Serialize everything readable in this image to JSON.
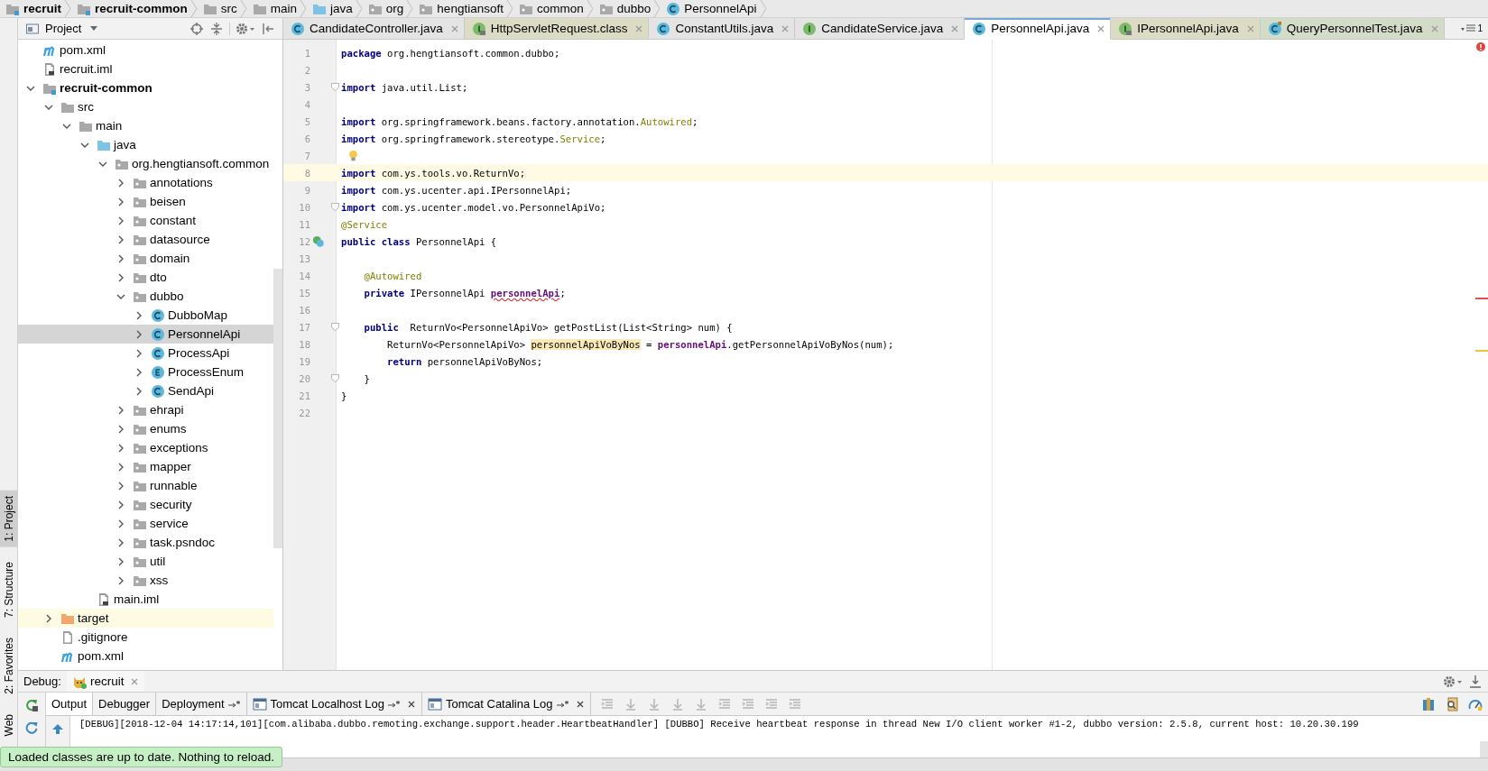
{
  "breadcrumbs": [
    {
      "label": "recruit",
      "kind": "module"
    },
    {
      "label": "recruit-common",
      "kind": "module"
    },
    {
      "label": "src",
      "kind": "folder"
    },
    {
      "label": "main",
      "kind": "folder"
    },
    {
      "label": "java",
      "kind": "source"
    },
    {
      "label": "org",
      "kind": "package"
    },
    {
      "label": "hengtiansoft",
      "kind": "package"
    },
    {
      "label": "common",
      "kind": "package"
    },
    {
      "label": "dubbo",
      "kind": "package"
    },
    {
      "label": "PersonnelApi",
      "kind": "class"
    }
  ],
  "project_panel": {
    "title": "Project",
    "tree": [
      {
        "label": "pom.xml",
        "kind": "maven",
        "selected": false
      },
      {
        "label": "recruit.iml",
        "kind": "iml",
        "selected": false
      },
      {
        "label": "recruit-common",
        "kind": "module",
        "selected": false,
        "expanded": true,
        "children": [
          {
            "label": "src",
            "kind": "folder",
            "selected": false,
            "expanded": true,
            "children": [
              {
                "label": "main",
                "kind": "folder",
                "selected": false,
                "expanded": true,
                "children": [
                  {
                    "label": "java",
                    "kind": "source",
                    "selected": false,
                    "expanded": true,
                    "children": [
                      {
                        "label": "org.hengtiansoft.common",
                        "kind": "package",
                        "selected": false,
                        "expanded": true,
                        "children": [
                          {
                            "label": "annotations",
                            "kind": "package",
                            "selected": false,
                            "expanded": false
                          },
                          {
                            "label": "beisen",
                            "kind": "package",
                            "selected": false,
                            "expanded": false
                          },
                          {
                            "label": "constant",
                            "kind": "package",
                            "selected": false,
                            "expanded": false
                          },
                          {
                            "label": "datasource",
                            "kind": "package",
                            "selected": false,
                            "expanded": false
                          },
                          {
                            "label": "domain",
                            "kind": "package",
                            "selected": false,
                            "expanded": false
                          },
                          {
                            "label": "dto",
                            "kind": "package",
                            "selected": false,
                            "expanded": false
                          },
                          {
                            "label": "dubbo",
                            "kind": "package",
                            "selected": false,
                            "expanded": true,
                            "children": [
                              {
                                "label": "DubboMap",
                                "kind": "class",
                                "selected": false,
                                "expanded": false
                              },
                              {
                                "label": "PersonnelApi",
                                "kind": "class",
                                "selected": true,
                                "expanded": false
                              },
                              {
                                "label": "ProcessApi",
                                "kind": "class",
                                "selected": false,
                                "expanded": false
                              },
                              {
                                "label": "ProcessEnum",
                                "kind": "enum",
                                "selected": false,
                                "expanded": false
                              },
                              {
                                "label": "SendApi",
                                "kind": "class",
                                "selected": false,
                                "expanded": false
                              }
                            ]
                          },
                          {
                            "label": "ehrapi",
                            "kind": "package",
                            "selected": false,
                            "expanded": false
                          },
                          {
                            "label": "enums",
                            "kind": "package",
                            "selected": false,
                            "expanded": false
                          },
                          {
                            "label": "exceptions",
                            "kind": "package",
                            "selected": false,
                            "expanded": false
                          },
                          {
                            "label": "mapper",
                            "kind": "package",
                            "selected": false,
                            "expanded": false
                          },
                          {
                            "label": "runnable",
                            "kind": "package",
                            "selected": false,
                            "expanded": false
                          },
                          {
                            "label": "security",
                            "kind": "package",
                            "selected": false,
                            "expanded": false
                          },
                          {
                            "label": "service",
                            "kind": "package",
                            "selected": false,
                            "expanded": false
                          },
                          {
                            "label": "task.psndoc",
                            "kind": "package",
                            "selected": false,
                            "expanded": false
                          },
                          {
                            "label": "util",
                            "kind": "package",
                            "selected": false,
                            "expanded": false
                          },
                          {
                            "label": "xss",
                            "kind": "package",
                            "selected": false,
                            "expanded": false
                          }
                        ]
                      }
                    ]
                  },
                  {
                    "label": "main.iml",
                    "kind": "iml",
                    "selected": false
                  }
                ]
              }
            ]
          },
          {
            "label": "target",
            "kind": "excluded",
            "selected": false,
            "expanded": false
          },
          {
            "label": ".gitignore",
            "kind": "file",
            "selected": false
          },
          {
            "label": "pom.xml",
            "kind": "maven",
            "selected": false
          }
        ]
      }
    ]
  },
  "side_tool_buttons": [
    {
      "label": "1: Project",
      "selected": true
    },
    {
      "label": "7: Structure",
      "selected": false
    },
    {
      "label": "2: Favorites",
      "selected": false
    },
    {
      "label": "Web",
      "selected": false
    }
  ],
  "editor_tabs": [
    {
      "label": "CandidateController.java",
      "kind": "class",
      "color": "#e4e4e4",
      "selected": false
    },
    {
      "label": "HttpServletRequest.class",
      "kind": "interface-locked",
      "color": "#dcdcc4",
      "selected": false
    },
    {
      "label": "ConstantUtils.java",
      "kind": "class",
      "color": "#e4e4e4",
      "selected": false
    },
    {
      "label": "CandidateService.java",
      "kind": "interface",
      "color": "#e4e4e4",
      "selected": false
    },
    {
      "label": "PersonnelApi.java",
      "kind": "class",
      "color": "#ffffff",
      "selected": true
    },
    {
      "label": "IPersonnelApi.java",
      "kind": "interface-locked",
      "color": "#dcdcc4",
      "selected": false
    },
    {
      "label": "QueryPersonnelTest.java",
      "kind": "test-class",
      "color": "#d2dcc6",
      "selected": false
    }
  ],
  "tab_overflow_count": "1",
  "code_lines": [
    {
      "number": "1",
      "tokens": [
        {
          "kind": "keyword",
          "text": "package"
        },
        {
          "kind": "text",
          "text": " org.hengtiansoft.common.dubbo;"
        }
      ]
    },
    {
      "number": "2"
    },
    {
      "number": "3",
      "kind": "fold",
      "tokens": [
        {
          "kind": "keyword",
          "text": "import"
        },
        {
          "kind": "text",
          "text": " java.util.List;"
        }
      ]
    },
    {
      "number": "4"
    },
    {
      "number": "5",
      "tokens": [
        {
          "kind": "keyword",
          "text": "import"
        },
        {
          "kind": "text",
          "text": " org.springframework.beans.factory.annotation."
        },
        {
          "kind": "annotation",
          "text": "Autowired"
        },
        {
          "kind": "text",
          "text": ";"
        }
      ]
    },
    {
      "number": "6",
      "tokens": [
        {
          "kind": "keyword",
          "text": "import"
        },
        {
          "kind": "text",
          "text": " org.springframework.stereotype."
        },
        {
          "kind": "annotation",
          "text": "Service"
        },
        {
          "kind": "text",
          "text": ";"
        }
      ]
    },
    {
      "number": "7",
      "kind": "bulb"
    },
    {
      "number": "8",
      "current": true,
      "tokens": [
        {
          "kind": "keyword",
          "text": "import"
        },
        {
          "kind": "text",
          "text": " com.ys.tools.vo.ReturnVo;"
        }
      ]
    },
    {
      "number": "9",
      "tokens": [
        {
          "kind": "keyword",
          "text": "import"
        },
        {
          "kind": "text",
          "text": " com.ys.ucenter.api.IPersonnelApi;"
        }
      ]
    },
    {
      "number": "10",
      "kind": "fold",
      "tokens": [
        {
          "kind": "keyword",
          "text": "import"
        },
        {
          "kind": "text",
          "text": " com.ys.ucenter.model.vo.PersonnelApiVo;"
        }
      ]
    },
    {
      "number": "11",
      "tokens": [
        {
          "kind": "annotation",
          "text": "@Service"
        }
      ]
    },
    {
      "number": "12",
      "kind": "class",
      "tokens": [
        {
          "kind": "keyword",
          "text": "public class"
        },
        {
          "kind": "text",
          "text": " PersonnelApi {"
        }
      ]
    },
    {
      "number": "13"
    },
    {
      "number": "14",
      "tokens": [
        {
          "kind": "annotation",
          "text": "    @Autowired"
        }
      ]
    },
    {
      "number": "15",
      "tokens": [
        {
          "kind": "keyword",
          "text": "    private"
        },
        {
          "kind": "text",
          "text": " IPersonnelApi "
        },
        {
          "kind": "field-error",
          "text": "personnelApi"
        },
        {
          "kind": "text",
          "text": ";"
        }
      ]
    },
    {
      "number": "16"
    },
    {
      "number": "17",
      "kind": "fold",
      "tokens": [
        {
          "kind": "keyword",
          "text": "    public"
        },
        {
          "kind": "text",
          "text": "  ReturnVo<PersonnelApiVo> getPostList(List<String> num) {"
        }
      ]
    },
    {
      "number": "18",
      "tokens": [
        {
          "kind": "text",
          "text": "        ReturnVo<PersonnelApiVo> "
        },
        {
          "kind": "highlight",
          "text": "personnelApiVoByNos"
        },
        {
          "kind": "text",
          "text": " = "
        },
        {
          "kind": "field",
          "text": "personnelApi"
        },
        {
          "kind": "text",
          "text": ".getPersonnelApiVoByNos(num);"
        }
      ]
    },
    {
      "number": "19",
      "tokens": [
        {
          "kind": "keyword",
          "text": "        return"
        },
        {
          "kind": "text",
          "text": " personnelApiVoByNos;"
        }
      ]
    },
    {
      "number": "20",
      "kind": "fold",
      "tokens": [
        {
          "kind": "text",
          "text": "    }"
        }
      ]
    },
    {
      "number": "21",
      "tokens": [
        {
          "kind": "text",
          "text": "}"
        }
      ]
    },
    {
      "number": "22"
    }
  ],
  "debug": {
    "label": "Debug:",
    "session": "recruit",
    "tabs": [
      {
        "label": "Output",
        "kind": "plain",
        "selected": true
      },
      {
        "label": "Debugger",
        "kind": "plain",
        "selected": false
      },
      {
        "label": "Deployment",
        "kind": "pinned",
        "selected": false
      },
      {
        "label": "Tomcat Localhost Log",
        "kind": "log",
        "selected": false
      },
      {
        "label": "Tomcat Catalina Log",
        "kind": "log",
        "selected": false
      }
    ],
    "output": [
      "[DEBUG][2018-12-04 14:17:14,101][com.alibaba.dubbo.remoting.exchange.support.header.HeartbeatHandler] [DUBBO] Receive heartbeat response in thread New I/O client worker #1-2, dubbo version: 2.5.8, current host: 10.20.30.199"
    ]
  },
  "notification": "Loaded classes are up to date. Nothing to reload."
}
